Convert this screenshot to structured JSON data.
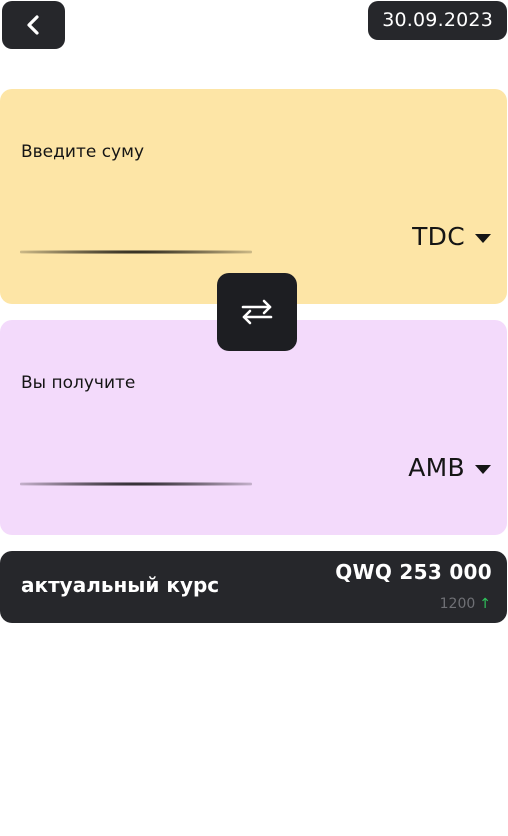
{
  "header": {
    "back_icon": "chevron-left-icon",
    "date": "30.09.2023"
  },
  "send": {
    "label": "Введите суму",
    "amount_value": "",
    "currency": "TDC",
    "currency_icon": "caret-down-icon",
    "background": "#fde5a6"
  },
  "swap": {
    "icon": "swap-arrows-icon"
  },
  "receive": {
    "label": "Вы получите",
    "amount_value": "",
    "currency": "AMB",
    "currency_icon": "caret-down-icon",
    "background": "#f3dafb"
  },
  "rate": {
    "label": "актуальный курс",
    "value": "QWQ 253 000",
    "change": "1200",
    "change_icon": "arrow-up-icon",
    "change_color": "#2fc25b"
  }
}
